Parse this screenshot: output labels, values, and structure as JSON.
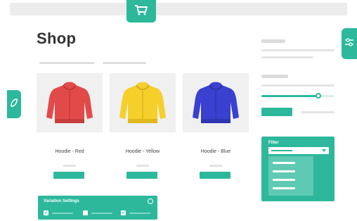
{
  "header": {
    "cart_icon": "shopping-cart-icon"
  },
  "page": {
    "title": "Shop"
  },
  "side_tabs": {
    "left_icon": "leaf-icon",
    "right_icon": "sliders-icon"
  },
  "products": [
    {
      "name": "Hoodie - Red",
      "color": "#e24a4a"
    },
    {
      "name": "Hoodie - Yellow",
      "color": "#f5cf2a"
    },
    {
      "name": "Hoodie - Blue",
      "color": "#3a40cf"
    }
  ],
  "variation_settings": {
    "title": "Variation Settings",
    "checkbox_icon": "check-icon"
  },
  "filter": {
    "title": "Filter"
  },
  "sidebar": {
    "price_slider_value": 0.78
  },
  "colors": {
    "accent": "#2db89c"
  }
}
